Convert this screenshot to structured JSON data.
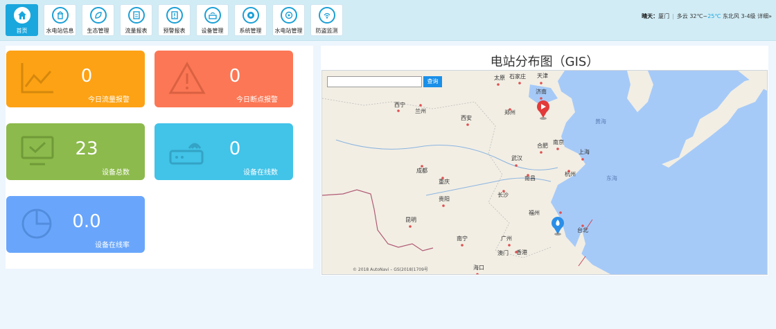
{
  "nav": [
    {
      "label": "首页",
      "icon": "home-icon",
      "active": true
    },
    {
      "label": "水电站信息",
      "icon": "station-info-icon"
    },
    {
      "label": "生态管理",
      "icon": "ecology-icon"
    },
    {
      "label": "流量报表",
      "icon": "flow-report-icon"
    },
    {
      "label": "预警报表",
      "icon": "alarm-report-icon"
    },
    {
      "label": "设备管理",
      "icon": "device-icon"
    },
    {
      "label": "系统管理",
      "icon": "system-icon"
    },
    {
      "label": "水电站管理",
      "icon": "station-manage-icon"
    },
    {
      "label": "防盗监测",
      "icon": "anti-theft-icon"
    }
  ],
  "weather": {
    "city_label": "晴天：",
    "city": "厦门",
    "desc": "多云",
    "temp_high": "32℃",
    "temp_sep": "~",
    "temp_low": "25℃",
    "wind": "东北风 3-4级",
    "detail": "详细»"
  },
  "cards": [
    {
      "value": "0",
      "label": "今日流量报警",
      "color": "#fda214",
      "icon": "line-chart-icon"
    },
    {
      "value": "0",
      "label": "今日断点报警",
      "color": "#fc7755",
      "icon": "warning-icon"
    },
    {
      "value": "23",
      "label": "设备总数",
      "color": "#8cba4c",
      "icon": "monitor-icon"
    },
    {
      "value": "0",
      "label": "设备在线数",
      "color": "#42c3e8",
      "icon": "router-icon"
    },
    {
      "value": "0.0",
      "label": "设备在线率",
      "color": "#69a6fb",
      "icon": "pie-chart-icon"
    }
  ],
  "map": {
    "title": "电站分布图（GIS）",
    "search_placeholder": "",
    "search_button": "查询",
    "copyright": "© 2018 AutoNavi – GS(2018)1709号",
    "cities": [
      "太原",
      "石家庄",
      "天津",
      "济南",
      "西宁",
      "兰州",
      "郑州",
      "西安",
      "合肥",
      "南京",
      "上海",
      "武汉",
      "杭州",
      "成都",
      "重庆",
      "南昌",
      "长沙",
      "贵阳",
      "福州",
      "昆明",
      "南宁",
      "广州",
      "台北",
      "澳门",
      "香港",
      "海口"
    ],
    "seas": [
      "黄海",
      "东海"
    ]
  }
}
